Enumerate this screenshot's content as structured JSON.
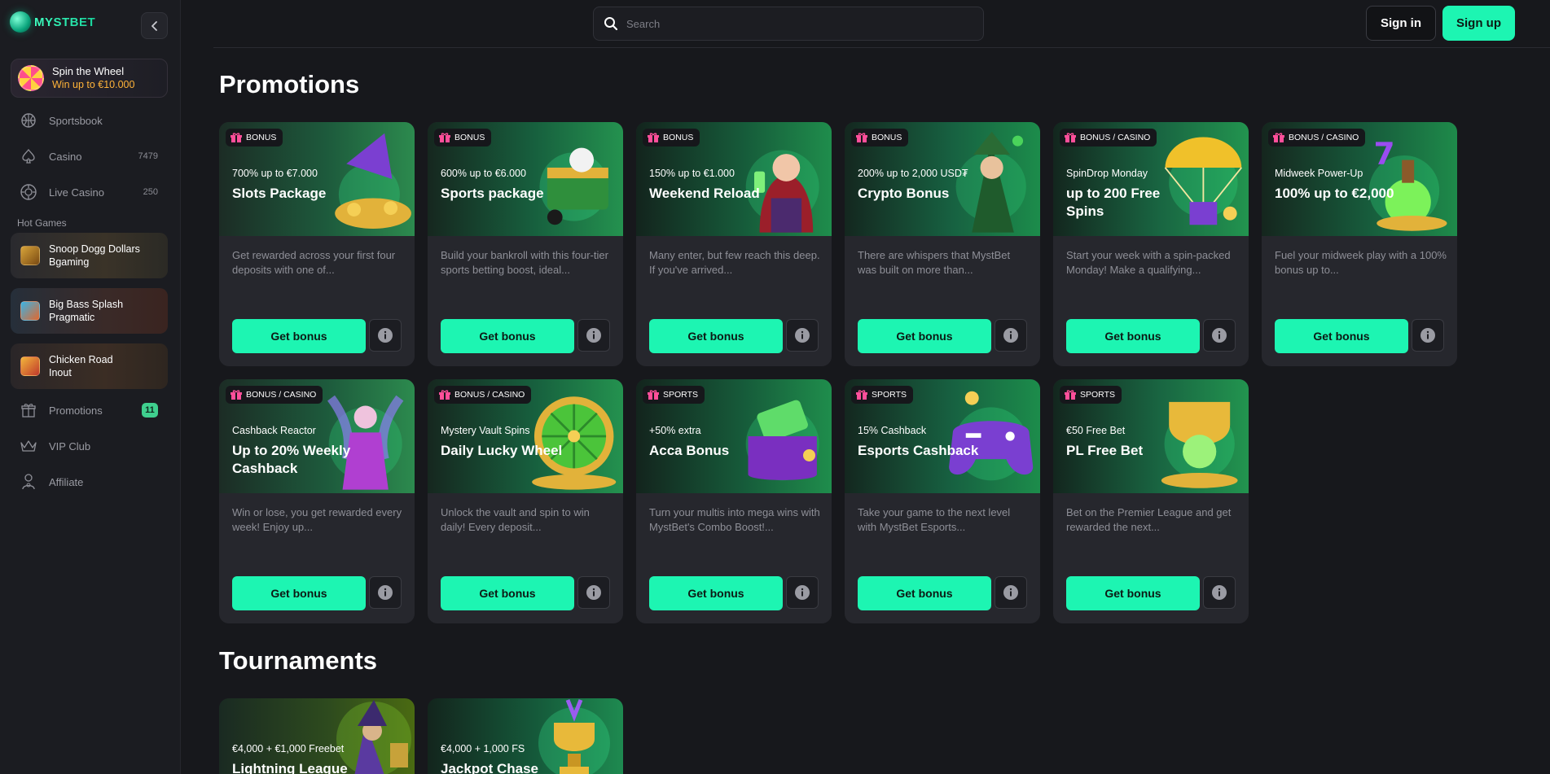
{
  "brand": {
    "name": "MYSTBET"
  },
  "sidebar": {
    "spin": {
      "title": "Spin the Wheel",
      "subtitle": "Win up to €10.000"
    },
    "nav_top": [
      {
        "label": "Sportsbook",
        "count": ""
      },
      {
        "label": "Casino",
        "count": "7479"
      },
      {
        "label": "Live Casino",
        "count": "250"
      }
    ],
    "hot_label": "Hot Games",
    "hot_games": [
      {
        "name": "Snoop Dogg Dollars",
        "provider": "Bgaming"
      },
      {
        "name": "Big Bass Splash",
        "provider": "Pragmatic"
      },
      {
        "name": "Chicken Road",
        "provider": "Inout"
      }
    ],
    "nav_bottom": [
      {
        "label": "Promotions",
        "badge": "11"
      },
      {
        "label": "VIP Club"
      },
      {
        "label": "Affiliate"
      }
    ]
  },
  "topbar": {
    "search_placeholder": "Search",
    "signin": "Sign in",
    "signup": "Sign up"
  },
  "promotions": {
    "title": "Promotions",
    "button_label": "Get bonus",
    "cards": [
      {
        "tag": "BONUS",
        "kicker": "700% up to €7.000",
        "title": "Slots Package",
        "desc": "Get rewarded across your first four deposits with one of..."
      },
      {
        "tag": "BONUS",
        "kicker": "600% up to €6.000",
        "title": "Sports package",
        "desc": "Build your bankroll with this four-tier sports betting boost, ideal..."
      },
      {
        "tag": "BONUS",
        "kicker": "150% up to €1.000",
        "title": "Weekend Reload",
        "desc": "Many enter, but few reach this deep. If you've arrived..."
      },
      {
        "tag": "BONUS",
        "kicker": "200% up to 2,000 USD₮",
        "title": "Crypto Bonus",
        "desc": "There are whispers that MystBet was built on more than..."
      },
      {
        "tag": "BONUS / CASINO",
        "kicker": "SpinDrop Monday",
        "title": "up to 200 Free Spins",
        "desc": "Start your week with a spin-packed Monday! Make a qualifying..."
      },
      {
        "tag": "BONUS / CASINO",
        "kicker": "Midweek Power-Up",
        "title": "100% up to €2,000",
        "desc": "Fuel your midweek play with a 100% bonus up to..."
      },
      {
        "tag": "BONUS / CASINO",
        "kicker": "Cashback Reactor",
        "title": "Up to 20% Weekly Cashback",
        "desc": "Win or lose, you get rewarded every week! Enjoy up..."
      },
      {
        "tag": "BONUS / CASINO",
        "kicker": "Mystery Vault Spins",
        "title": "Daily Lucky Wheel",
        "desc": "Unlock the vault and spin to win daily! Every deposit..."
      },
      {
        "tag": "SPORTS",
        "kicker": "+50% extra",
        "title": "Acca Bonus",
        "desc": "Turn your multis into mega wins with MystBet's Combo Boost!..."
      },
      {
        "tag": "SPORTS",
        "kicker": "15% Cashback",
        "title": "Esports Cashback",
        "desc": "Take your game to the next level with MystBet Esports..."
      },
      {
        "tag": "SPORTS",
        "kicker": "€50 Free Bet",
        "title": "PL Free Bet",
        "desc": "Bet on the Premier League and get rewarded the next..."
      }
    ]
  },
  "tournaments": {
    "title": "Tournaments",
    "cards": [
      {
        "kicker": "€4,000 + €1,000 Freebet",
        "title": "Lightning League"
      },
      {
        "kicker": "€4,000 + 1,000 FS",
        "title": "Jackpot Chase"
      }
    ]
  },
  "colors": {
    "accent": "#1df5b2",
    "background": "#17181c",
    "card": "#26272d",
    "gold": "#ffb339",
    "badge_green": "#3fcf8e",
    "tag_gift": "#ff4f9a"
  },
  "icons": {
    "search": "search-icon",
    "collapse": "chevron-left-icon",
    "info": "info-icon",
    "gift": "gift-icon"
  }
}
